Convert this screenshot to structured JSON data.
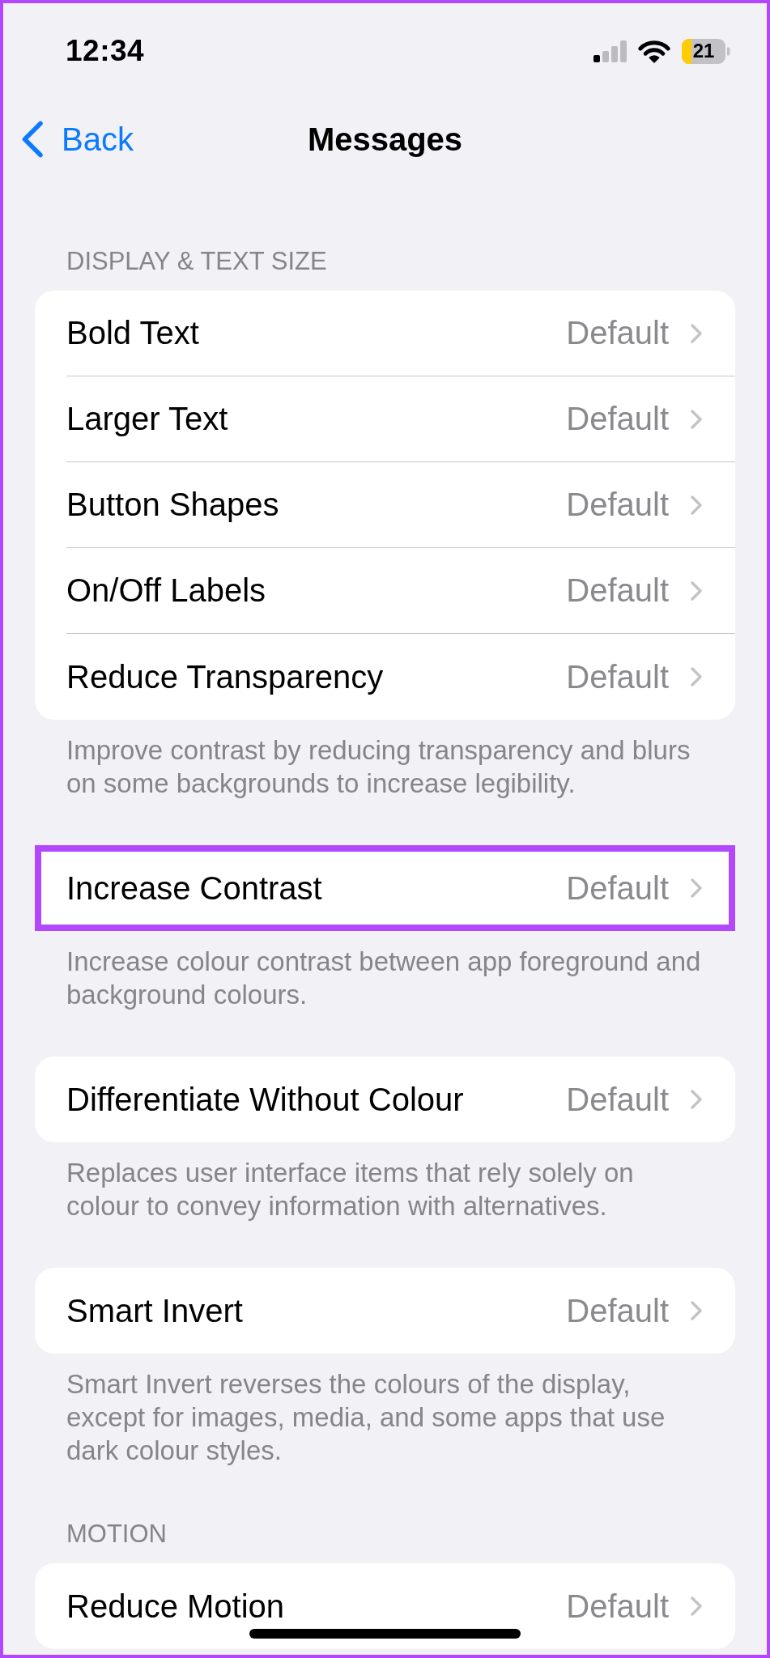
{
  "status_bar": {
    "time": "12:34",
    "battery_text": "21"
  },
  "nav_bar": {
    "back_label": "Back",
    "title": "Messages"
  },
  "sections": [
    {
      "header": "DISPLAY & TEXT SIZE",
      "rows": [
        {
          "label": "Bold Text",
          "value": "Default",
          "highlighted": false
        },
        {
          "label": "Larger Text",
          "value": "Default",
          "highlighted": false
        },
        {
          "label": "Button Shapes",
          "value": "Default",
          "highlighted": false
        },
        {
          "label": "On/Off Labels",
          "value": "Default",
          "highlighted": false
        },
        {
          "label": "Reduce Transparency",
          "value": "Default",
          "highlighted": false
        }
      ],
      "footer": "Improve contrast by reducing transparency and blurs on some backgrounds to increase legibility."
    },
    {
      "rows": [
        {
          "label": "Increase Contrast",
          "value": "Default",
          "highlighted": true
        }
      ],
      "footer": "Increase colour contrast between app foreground and background colours."
    },
    {
      "rows": [
        {
          "label": "Differentiate Without Colour",
          "value": "Default",
          "highlighted": false
        }
      ],
      "footer": "Replaces user interface items that rely solely on colour to convey information with alternatives."
    },
    {
      "rows": [
        {
          "label": "Smart Invert",
          "value": "Default",
          "highlighted": false
        }
      ],
      "footer": "Smart Invert reverses the colours of the display, except for images, media, and some apps that use dark colour styles."
    },
    {
      "header": "MOTION",
      "rows": [
        {
          "label": "Reduce Motion",
          "value": "Default",
          "highlighted": false
        }
      ]
    }
  ]
}
